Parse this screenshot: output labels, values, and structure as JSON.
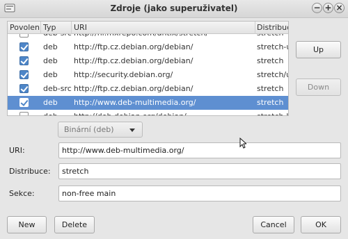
{
  "window": {
    "title": "Zdroje (jako superuživatel)",
    "buttons": {
      "minimize": "−",
      "maximize": "+",
      "close": "×"
    }
  },
  "table": {
    "columns": [
      "Povolen",
      "Typ",
      "URI",
      "Distribuce"
    ],
    "rows": [
      {
        "enabled": false,
        "type": "deb-src",
        "uri": "http://nl.mxrepo.com/antix/stretch/",
        "dist": "stretch"
      },
      {
        "enabled": true,
        "type": "deb",
        "uri": "http://ftp.cz.debian.org/debian/",
        "dist": "stretch-up"
      },
      {
        "enabled": true,
        "type": "deb",
        "uri": "http://ftp.cz.debian.org/debian/",
        "dist": "stretch"
      },
      {
        "enabled": true,
        "type": "deb",
        "uri": "http://security.debian.org/",
        "dist": "stretch/up"
      },
      {
        "enabled": true,
        "type": "deb-src",
        "uri": "http://ftp.cz.debian.org/debian/",
        "dist": "stretch"
      },
      {
        "enabled": true,
        "type": "deb",
        "uri": "http://www.deb-multimedia.org/",
        "dist": "stretch",
        "selected": true
      },
      {
        "enabled": false,
        "type": "deb",
        "uri": "http://deb.debian.org/debian/",
        "dist": "stretch-ba"
      }
    ]
  },
  "side_buttons": {
    "up": "Up",
    "down": "Down"
  },
  "type_combo": {
    "value": "Binární (deb)"
  },
  "form": {
    "uri_label": "URI:",
    "uri_value": "http://www.deb-multimedia.org/",
    "dist_label": "Distribuce:",
    "dist_value": "stretch",
    "sections_label": "Sekce:",
    "sections_value": "non-free main"
  },
  "footer": {
    "new": "New",
    "delete": "Delete",
    "cancel": "Cancel",
    "ok": "OK"
  },
  "colors": {
    "selection": "#5e8fd1",
    "checkbox": "#4e86c8"
  }
}
